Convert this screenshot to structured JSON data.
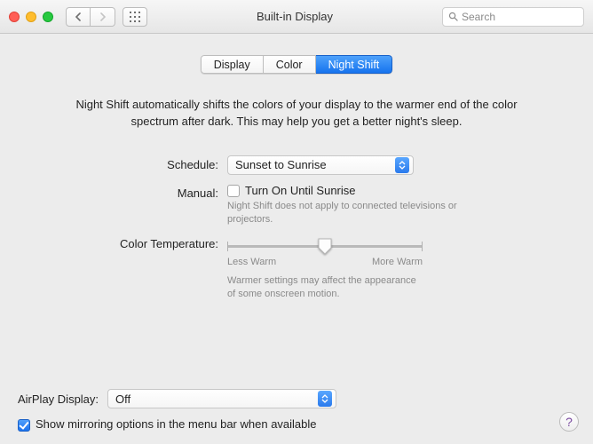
{
  "window": {
    "title": "Built-in Display"
  },
  "search": {
    "placeholder": "Search"
  },
  "tabs": [
    {
      "label": "Display"
    },
    {
      "label": "Color"
    },
    {
      "label": "Night Shift"
    }
  ],
  "description": "Night Shift automatically shifts the colors of your display to the warmer end of the color spectrum after dark. This may help you get a better night's sleep.",
  "schedule": {
    "label": "Schedule:",
    "value": "Sunset to Sunrise"
  },
  "manual": {
    "label": "Manual:",
    "option": "Turn On Until Sunrise",
    "hint": "Night Shift does not apply to connected televisions or projectors."
  },
  "colortemp": {
    "label": "Color Temperature:",
    "min_label": "Less Warm",
    "max_label": "More Warm",
    "hint": "Warmer settings may affect the appearance of some onscreen motion."
  },
  "airplay": {
    "label": "AirPlay Display:",
    "value": "Off"
  },
  "mirroring": {
    "label": "Show mirroring options in the menu bar when available"
  },
  "help": {
    "label": "?"
  }
}
